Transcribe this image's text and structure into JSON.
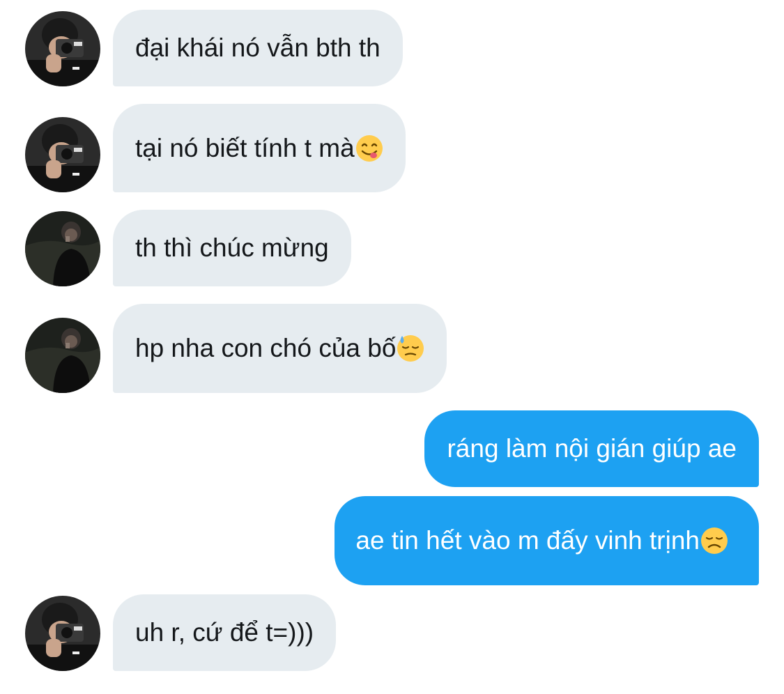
{
  "conversation": {
    "messages": [
      {
        "sender": "them",
        "avatar": "camera-selfie",
        "text": "đại khái nó vẫn bth th"
      },
      {
        "sender": "them",
        "avatar": "camera-selfie",
        "text": "tại nó biết tính t mà",
        "emoji": "yum-face"
      },
      {
        "sender": "them",
        "avatar": "dark-selfie",
        "text": "th thì chúc mừng"
      },
      {
        "sender": "them",
        "avatar": "dark-selfie",
        "text": "hp nha con chó của bố",
        "emoji": "downcast-sweat-face"
      },
      {
        "sender": "me",
        "text": "ráng làm nội gián giúp ae"
      },
      {
        "sender": "me",
        "text": "ae tin hết vào m đấy vinh trịnh",
        "emoji": "disappointed-face"
      },
      {
        "sender": "them",
        "avatar": "camera-selfie",
        "text": "uh r, cứ để t=)))"
      }
    ]
  },
  "colors": {
    "incoming_bubble": "#e6ecf0",
    "outgoing_bubble": "#1da1f2",
    "incoming_text": "#14171a",
    "outgoing_text": "#ffffff",
    "background": "#ffffff"
  }
}
